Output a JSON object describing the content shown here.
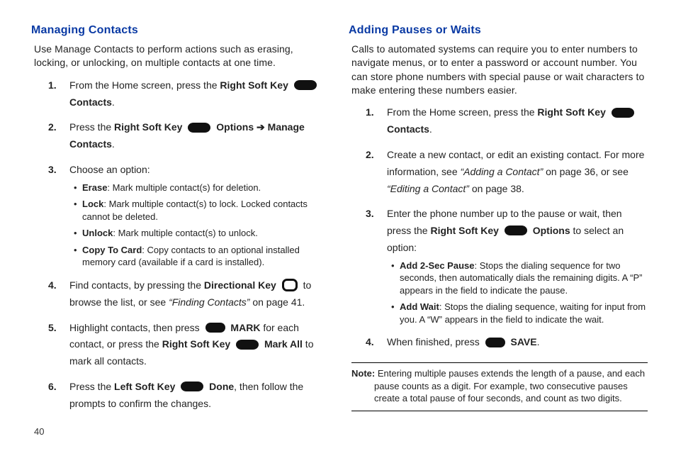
{
  "page_number": "40",
  "left": {
    "heading": "Managing Contacts",
    "intro": "Use Manage Contacts to perform actions such as erasing, locking, or unlocking, on multiple contacts at one time.",
    "s1_a": "From the Home screen, press the ",
    "s1_b": "Right Soft Key ",
    "s1_c": " Contacts",
    "s1_d": ".",
    "s2_a": "Press the ",
    "s2_b": "Right Soft Key ",
    "s2_c": " Options ",
    "s2_arrow": "➔",
    "s2_d": " Manage Contacts",
    "s2_e": ".",
    "s3": "Choose an option:",
    "s3_items": {
      "i1_b": "Erase",
      "i1_t": ": Mark multiple contact(s) for deletion.",
      "i2_b": "Lock",
      "i2_t": ": Mark multiple contact(s) to lock. Locked contacts cannot be deleted.",
      "i3_b": "Unlock",
      "i3_t": ": Mark multiple contact(s) to unlock.",
      "i4_b": "Copy To Card",
      "i4_t": ": Copy contacts to an optional installed memory card (available if a card is installed)."
    },
    "s4_a": "Find contacts, by pressing the ",
    "s4_b": "Directional Key ",
    "s4_c": " to browse the list, or see ",
    "s4_ref": "“Finding Contacts”",
    "s4_d": " on page 41.",
    "s5_a": "Highlight contacts, then press ",
    "s5_b": " MARK",
    "s5_c": " for each contact, or press the ",
    "s5_d": "Right Soft Key ",
    "s5_e": " Mark All",
    "s5_f": " to mark all contacts.",
    "s6_a": "Press the ",
    "s6_b": "Left Soft Key ",
    "s6_c": " Done",
    "s6_d": ", then follow the prompts to confirm the changes."
  },
  "right": {
    "heading": "Adding Pauses or Waits",
    "intro": "Calls to automated systems can require you to enter numbers to navigate menus, or to enter a password or account number. You can store phone numbers with special pause or wait characters to make entering these numbers easier.",
    "s1_a": "From the Home screen, press the ",
    "s1_b": "Right Soft Key ",
    "s1_c": " Contacts",
    "s1_d": ".",
    "s2_a": "Create a new contact, or edit an existing contact. For more information, see ",
    "s2_ref1": "“Adding a Contact”",
    "s2_b": " on page 36, or see ",
    "s2_ref2": "“Editing a Contact”",
    "s2_c": " on page 38.",
    "s3_a": "Enter the phone number up to the pause or wait, then press the ",
    "s3_b": "Right Soft Key ",
    "s3_c": " Options",
    "s3_d": " to select an option:",
    "s3_items": {
      "i1_b": "Add 2-Sec Pause",
      "i1_t": ": Stops the dialing sequence for two seconds, then automatically dials the remaining digits. A “P” appears in the field to indicate the pause.",
      "i2_b": "Add Wait",
      "i2_t": ": Stops the dialing sequence, waiting for input from you. A “W” appears in the field to indicate the wait."
    },
    "s4_a": "When finished, press ",
    "s4_b": " SAVE",
    "s4_c": ".",
    "note_b": "Note:",
    "note_t": " Entering multiple pauses extends the length of a pause, and each pause counts as a digit. For example, two consecutive pauses create a total pause of four seconds, and count as two digits."
  }
}
